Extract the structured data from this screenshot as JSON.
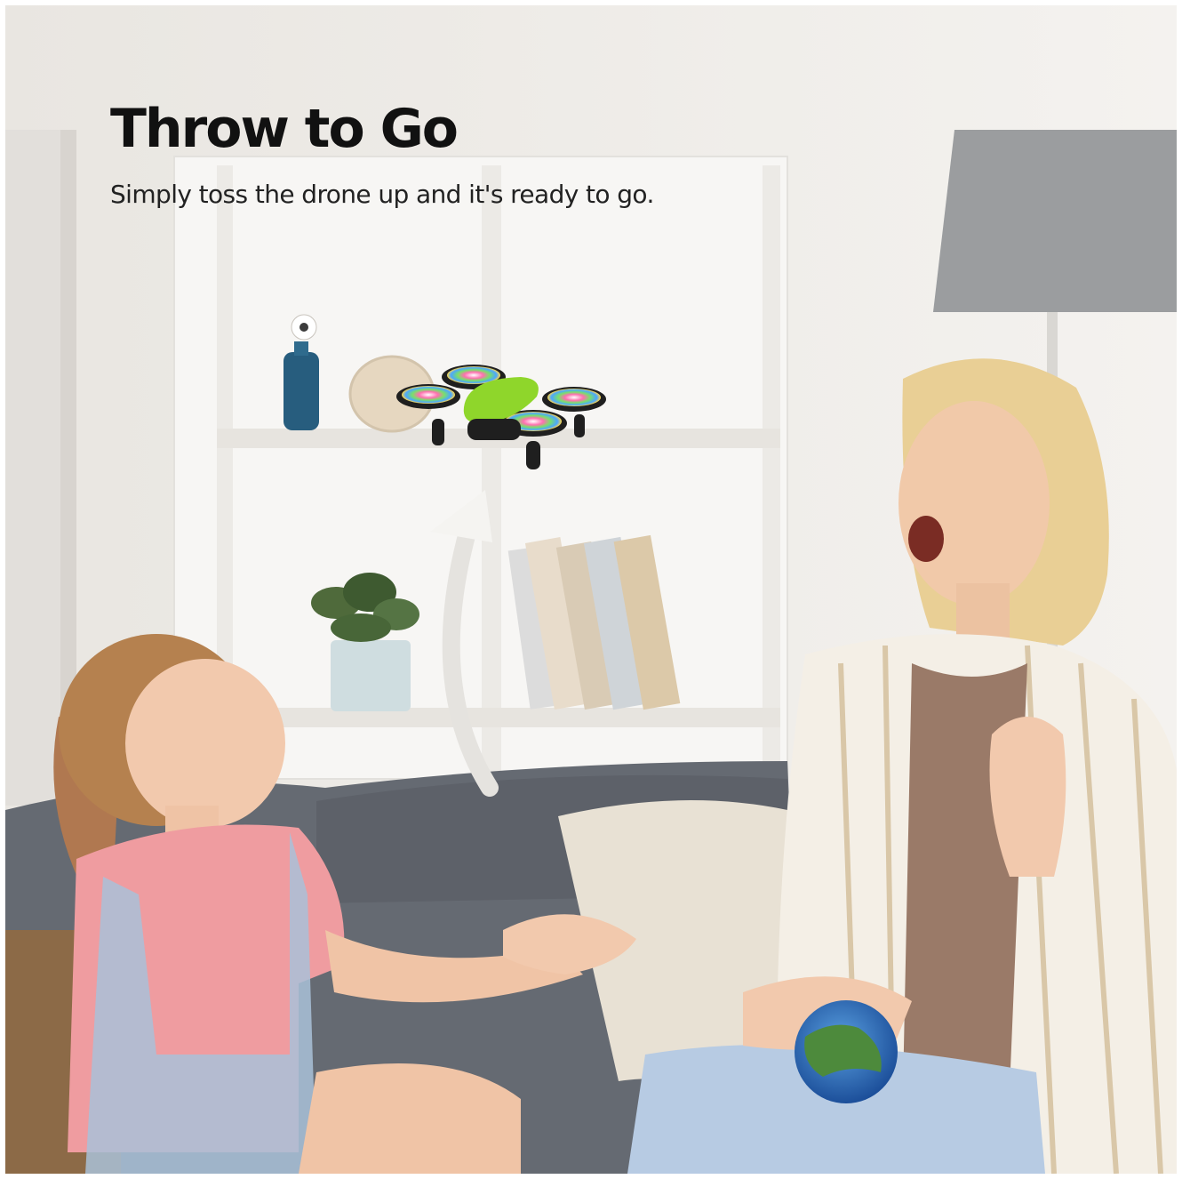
{
  "headline": "Throw to Go",
  "subheadline": "Simply toss the drone up and it's ready to go.",
  "colors": {
    "text_dark": "#111111",
    "drone_shell": "#8fd62b",
    "drone_frame": "#1f1f1f",
    "sofa": "#6b6e73",
    "child_shirt": "#ef9ca0",
    "adult_shirt_stripe": "#d9c7a8"
  },
  "icons": [
    "drone-icon",
    "throw-arrow-icon"
  ]
}
